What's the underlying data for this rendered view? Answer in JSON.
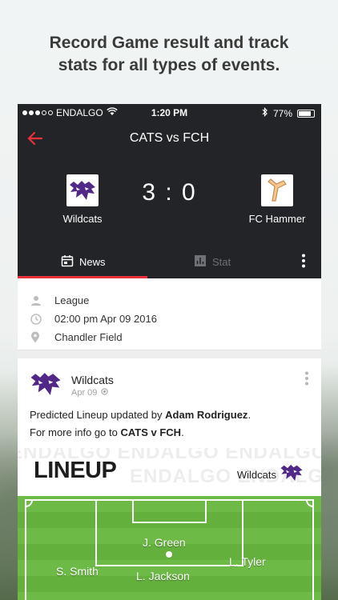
{
  "promo": {
    "headline_line1": "Record Game result and track",
    "headline_line2": "stats for all types of events."
  },
  "status_bar": {
    "carrier": "ENDALGO",
    "time": "1:20 PM",
    "battery": "77%",
    "battery_level": 0.77
  },
  "app_bar": {
    "back_icon": "arrow-left-icon",
    "title": "CATS vs FCH"
  },
  "scoreboard": {
    "home_team": "Wildcats",
    "away_team": "FC Hammer",
    "score": "3 : 0"
  },
  "tabs": [
    {
      "label": "News",
      "icon": "calendar-icon",
      "active": true
    },
    {
      "label": "Stat",
      "icon": "bar-chart-icon",
      "active": false
    }
  ],
  "colors": {
    "dark_bg": "#232427",
    "accent": "#e8303c",
    "wildcats_purple": "#512888",
    "pitch_green": "#6dba46"
  },
  "event_info": {
    "category": "League",
    "datetime": "02:00 pm Apr 09 2016",
    "location": "Chandler Field"
  },
  "post": {
    "author": "Wildcats",
    "date": "Apr 09",
    "text_prefix": "Predicted Lineup updated by ",
    "updated_by": "Adam Rodriguez",
    "text_suffix": ".",
    "line2_prefix": "For more info go to ",
    "link": "CATS v FCH",
    "line2_suffix": "."
  },
  "lineup": {
    "title": "LINEUP",
    "team": "Wildcats",
    "watermark": "ENDALGO",
    "players": [
      "J. Green",
      "L. Tyler",
      "S. Smith",
      "L. Jackson"
    ]
  }
}
